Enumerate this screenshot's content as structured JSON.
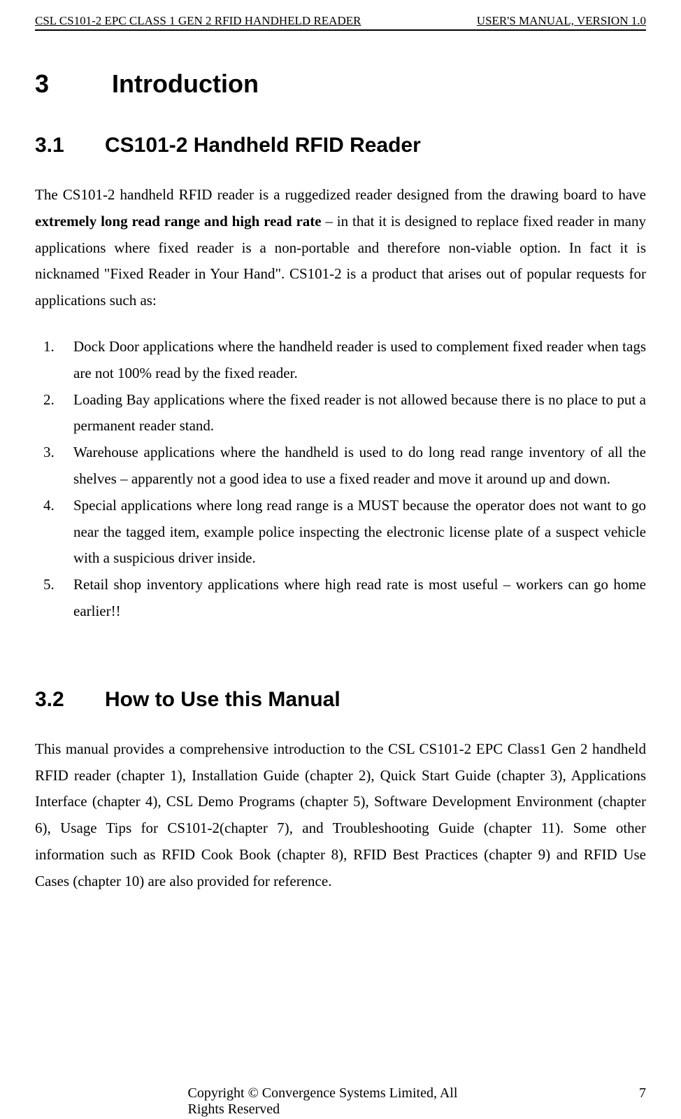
{
  "header": {
    "left": "CSL CS101-2 EPC CLASS 1 GEN 2 RFID HANDHELD READER",
    "right": "USER'S  MANUAL,  VERSION  1.0"
  },
  "h1": {
    "num": "3",
    "title": "Introduction"
  },
  "h2a": {
    "num": "3.1",
    "title": "CS101-2 Handheld RFID Reader"
  },
  "para1": {
    "pre": "The CS101-2 handheld RFID reader is a ruggedized reader designed from the drawing board to have ",
    "bold": "extremely long read range and high read rate",
    "post": " – in that it is designed to replace fixed reader in many applications where fixed reader is a non-portable and therefore non-viable option.   In fact it is nicknamed \"Fixed Reader in Your Hand\".   CS101-2 is a product that arises out of popular requests for applications such as:"
  },
  "list": [
    "Dock Door applications where the handheld reader is used to complement fixed reader when tags are not 100% read by the fixed reader.",
    "Loading Bay applications where the fixed reader is not allowed because there is no place to put a permanent reader stand.",
    "Warehouse applications where the handheld is used to do long read range inventory of all the shelves – apparently not a good idea to use a fixed reader and move it around up and down.",
    "Special applications where long read range is a MUST because the operator does not want to go near the tagged item, example police inspecting the electronic license plate of a suspect vehicle with a suspicious driver inside.",
    "Retail shop inventory applications where high read rate is most useful – workers can go home earlier!!"
  ],
  "h2b": {
    "num": "3.2",
    "title": "How to Use this Manual"
  },
  "para2": "This manual provides a comprehensive introduction to the CSL CS101-2 EPC Class1 Gen 2 handheld RFID reader (chapter 1), Installation Guide (chapter 2), Quick Start Guide (chapter 3), Applications Interface (chapter 4), CSL Demo Programs (chapter 5), Software Development Environment (chapter 6), Usage Tips for CS101-2(chapter 7), and Troubleshooting Guide (chapter 11). Some other information such as RFID Cook Book (chapter 8), RFID Best Practices (chapter 9) and RFID Use Cases (chapter 10) are also provided for reference.",
  "footer": {
    "center": "Copyright © Convergence Systems Limited, All Rights Reserved",
    "right": "7"
  }
}
